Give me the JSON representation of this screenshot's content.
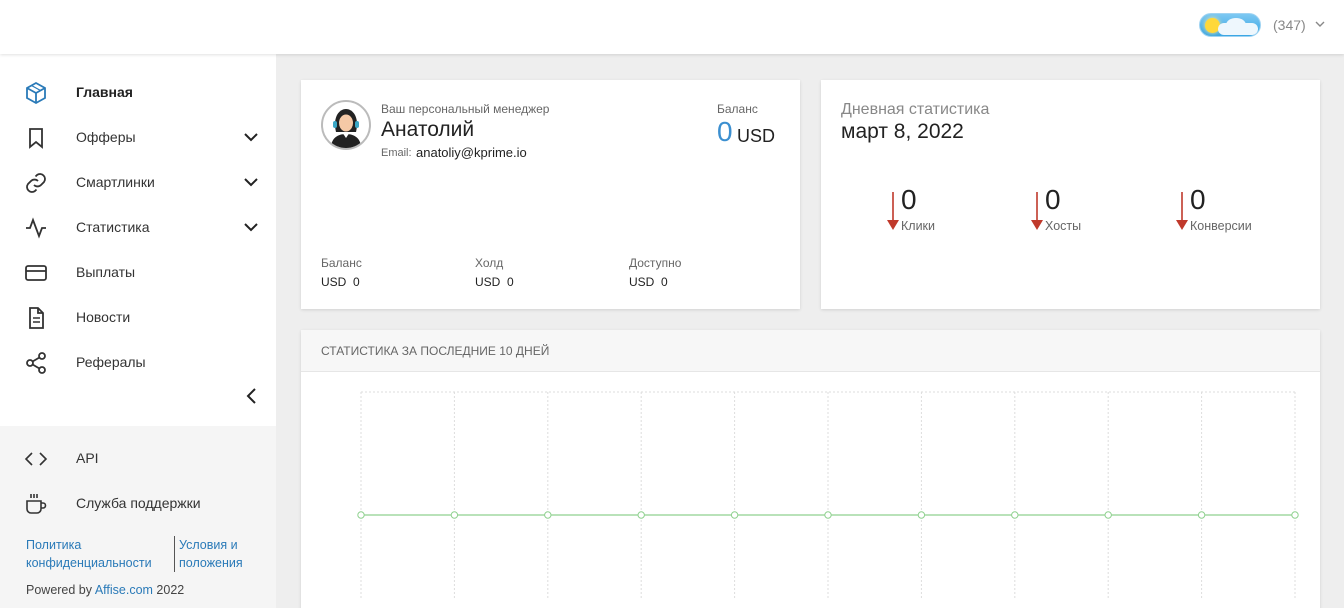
{
  "header": {
    "counter": "(347)"
  },
  "sidebar": {
    "items": [
      {
        "label": "Главная",
        "icon": "cube-icon",
        "has_chevron": false,
        "active": true
      },
      {
        "label": "Офферы",
        "icon": "bookmark-icon",
        "has_chevron": true,
        "active": false
      },
      {
        "label": "Смартлинки",
        "icon": "link-icon",
        "has_chevron": true,
        "active": false
      },
      {
        "label": "Статистика",
        "icon": "activity-icon",
        "has_chevron": true,
        "active": false
      },
      {
        "label": "Выплаты",
        "icon": "credit-card-icon",
        "has_chevron": false,
        "active": false
      },
      {
        "label": "Новости",
        "icon": "document-icon",
        "has_chevron": false,
        "active": false
      },
      {
        "label": "Рефералы",
        "icon": "share-icon",
        "has_chevron": false,
        "active": false
      }
    ],
    "bottom_items": [
      {
        "label": "API",
        "icon": "code-icon"
      },
      {
        "label": "Служба поддержки",
        "icon": "coffee-icon"
      }
    ],
    "privacy_line1": "Политика",
    "privacy_line2": "конфиденциальности",
    "terms_line1": "Условия и",
    "terms_line2": "положения",
    "powered_prefix": "Powered by",
    "powered_brand": "Affise.com",
    "powered_year": "2022"
  },
  "manager": {
    "caption": "Ваш персональный менеджер",
    "name": "Анатолий",
    "email_label": "Email:",
    "email": "anatoliy@kprime.io",
    "balance_caption": "Баланс",
    "balance_value": "0",
    "balance_currency": "USD",
    "finance": [
      {
        "caption": "Баланс",
        "currency": "USD",
        "value": "0"
      },
      {
        "caption": "Холд",
        "currency": "USD",
        "value": "0"
      },
      {
        "caption": "Доступно",
        "currency": "USD",
        "value": "0"
      }
    ]
  },
  "daily": {
    "title": "Дневная статистика",
    "date": "март 8, 2022",
    "metrics": [
      {
        "value": "0",
        "label": "Клики"
      },
      {
        "value": "0",
        "label": "Хосты"
      },
      {
        "value": "0",
        "label": "Конверсии"
      }
    ],
    "arrow_color": "#c0392b"
  },
  "chart": {
    "title": "СТАТИСТИКА ЗА ПОСЛЕДНИЕ 10 ДНЕЙ"
  },
  "chart_data": {
    "type": "line",
    "x_count": 11,
    "series": [
      {
        "values": [
          0,
          0,
          0,
          0,
          0,
          0,
          0,
          0,
          0,
          0,
          0
        ],
        "color": "#8fd18f"
      }
    ],
    "grid": true
  }
}
